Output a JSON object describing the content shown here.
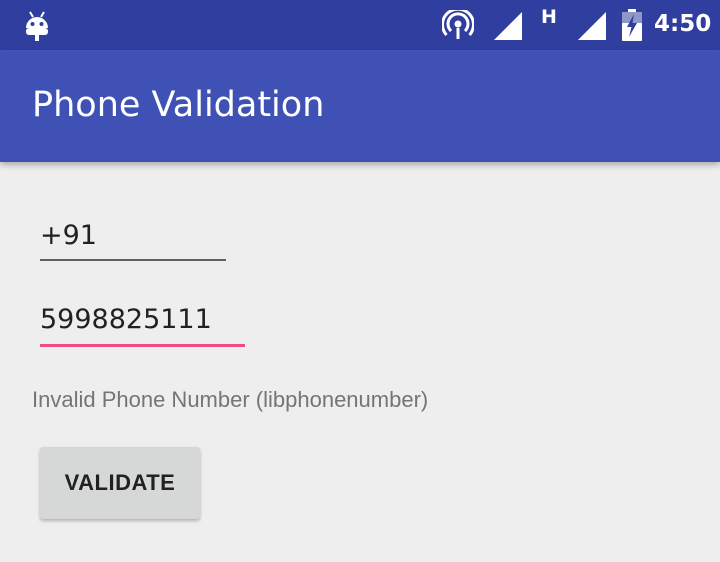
{
  "status_bar": {
    "time": "4:50",
    "network_type": "H",
    "icons": [
      "android-robot-icon",
      "hotspot-icon",
      "signal-icon",
      "signal-icon",
      "battery-charging-icon"
    ]
  },
  "app_bar": {
    "title": "Phone Validation",
    "color": "#3f51b5"
  },
  "form": {
    "country_code": "+91",
    "phone_number": "5998825111",
    "result_text": "Invalid Phone Number (libphonenumber)",
    "validate_label": "VALIDATE",
    "focus_color": "#ef4c7f"
  }
}
